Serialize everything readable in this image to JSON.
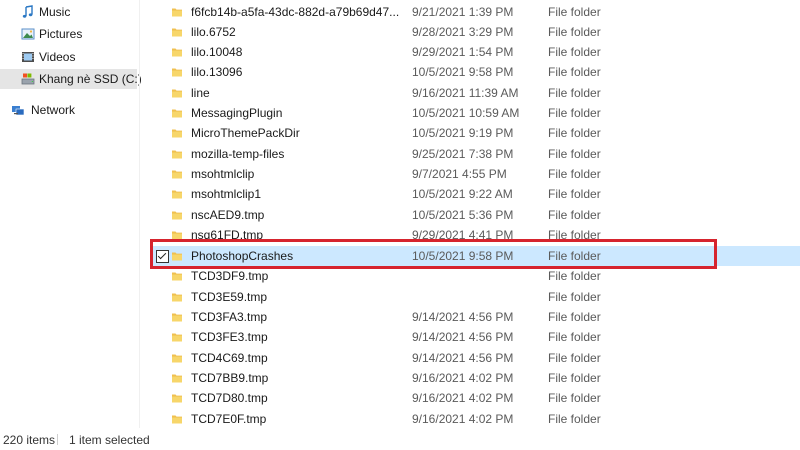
{
  "nav": {
    "items": [
      {
        "label": "Music",
        "icon": "music-icon"
      },
      {
        "label": "Pictures",
        "icon": "pictures-icon"
      },
      {
        "label": "Videos",
        "icon": "videos-icon"
      },
      {
        "label": "Khang nè SSD (C:)",
        "icon": "drive-icon",
        "selected": true
      },
      {
        "label": "Network",
        "icon": "network-icon"
      }
    ]
  },
  "files": [
    {
      "name": "f6fcb14b-a5fa-43dc-882d-a79b69d47...",
      "date": "9/21/2021 1:39 PM",
      "type": "File folder"
    },
    {
      "name": "lilo.6752",
      "date": "9/28/2021 3:29 PM",
      "type": "File folder"
    },
    {
      "name": "lilo.10048",
      "date": "9/29/2021 1:54 PM",
      "type": "File folder"
    },
    {
      "name": "lilo.13096",
      "date": "10/5/2021 9:58 PM",
      "type": "File folder"
    },
    {
      "name": "line",
      "date": "9/16/2021 11:39 AM",
      "type": "File folder"
    },
    {
      "name": "MessagingPlugin",
      "date": "10/5/2021 10:59 AM",
      "type": "File folder"
    },
    {
      "name": "MicroThemePackDir",
      "date": "10/5/2021 9:19 PM",
      "type": "File folder"
    },
    {
      "name": "mozilla-temp-files",
      "date": "9/25/2021 7:38 PM",
      "type": "File folder"
    },
    {
      "name": "msohtmlclip",
      "date": "9/7/2021 4:55 PM",
      "type": "File folder"
    },
    {
      "name": "msohtmlclip1",
      "date": "10/5/2021 9:22 AM",
      "type": "File folder"
    },
    {
      "name": "nscAED9.tmp",
      "date": "10/5/2021 5:36 PM",
      "type": "File folder"
    },
    {
      "name": "nsq61FD.tmp",
      "date": "9/29/2021 4:41 PM",
      "type": "File folder"
    },
    {
      "name": "PhotoshopCrashes",
      "date": "10/5/2021 9:58 PM",
      "type": "File folder",
      "selected": true
    },
    {
      "name": "TCD3DF9.tmp",
      "date": "",
      "type": "File folder"
    },
    {
      "name": "TCD3E59.tmp",
      "date": "",
      "type": "File folder"
    },
    {
      "name": "TCD3FA3.tmp",
      "date": "9/14/2021 4:56 PM",
      "type": "File folder"
    },
    {
      "name": "TCD3FE3.tmp",
      "date": "9/14/2021 4:56 PM",
      "type": "File folder"
    },
    {
      "name": "TCD4C69.tmp",
      "date": "9/14/2021 4:56 PM",
      "type": "File folder"
    },
    {
      "name": "TCD7BB9.tmp",
      "date": "9/16/2021 4:02 PM",
      "type": "File folder"
    },
    {
      "name": "TCD7D80.tmp",
      "date": "9/16/2021 4:02 PM",
      "type": "File folder"
    },
    {
      "name": "TCD7E0F.tmp",
      "date": "9/16/2021 4:02 PM",
      "type": "File folder"
    }
  ],
  "status": {
    "count": "220 items",
    "selection": "1 item selected"
  },
  "colors": {
    "selection": "#cce8ff",
    "highlight_box": "#d6242e",
    "folder": "#f0c050"
  }
}
